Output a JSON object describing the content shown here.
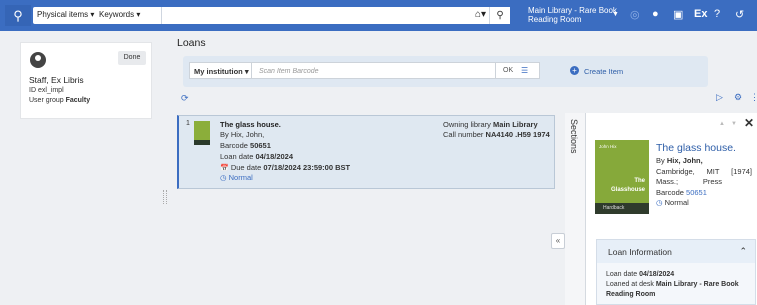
{
  "topbar": {
    "logo_icon": "primo-logo-icon",
    "search_scope": "Physical items",
    "search_field": "Keywords",
    "location_line1": "Main Library - Rare Book",
    "location_line2": "Reading Room",
    "icons": [
      "home-icon",
      "search-icon",
      "flag-icon",
      "user-icon",
      "tasks-icon",
      "ex-libris-icon",
      "help-icon",
      "history-icon"
    ],
    "ex_label": "Ex"
  },
  "user": {
    "name": "Staff, Ex Libris",
    "id_label": "ID",
    "id_value": "exl_impl",
    "group_label": "User group",
    "group_value": "Faculty",
    "done_label": "Done"
  },
  "page": {
    "title": "Loans",
    "institution_label": "My institution",
    "scan_placeholder": "Scan Item Barcode",
    "ok_label": "OK",
    "create_label": "Create Item"
  },
  "loan": {
    "row_number": "1",
    "title": "The glass house.",
    "author_label": "By",
    "author": "Hix, John,",
    "barcode_label": "Barcode",
    "barcode": "50651",
    "loan_date_label": "Loan date",
    "loan_date": "04/18/2024",
    "due_date_label": "Due date",
    "due_date": "07/18/2024 23:59:00 BST",
    "status": "Normal",
    "owning_label": "Owning library",
    "owning_value": "Main Library",
    "call_label": "Call number",
    "call_value": "NA4140 .H59 1974"
  },
  "details": {
    "sections_label": "Sections",
    "title": "The glass house.",
    "author_label": "By",
    "author": "Hix, John,",
    "pub_row1": [
      "Cambridge,",
      "MIT",
      "[1974]"
    ],
    "pub_row2": [
      "Mass.;",
      "Press"
    ],
    "barcode_label": "Barcode",
    "barcode": "50651",
    "status": "Normal",
    "cover_author": "John Hix",
    "cover_title_line1": "The",
    "cover_title_line2": "Glasshouse",
    "cover_band": "Hardback"
  },
  "loan_information": {
    "header": "Loan Information",
    "loan_date_label": "Loan date",
    "loan_date": "04/18/2024",
    "desk_label": "Loaned at desk",
    "desk_value_line1": "Main Library - Rare Book",
    "desk_value_line2": "Reading Room"
  },
  "colors": {
    "topbar": "#3b6dc1",
    "accent": "#3b6dc1",
    "card_bg": "#dfe8f1"
  }
}
